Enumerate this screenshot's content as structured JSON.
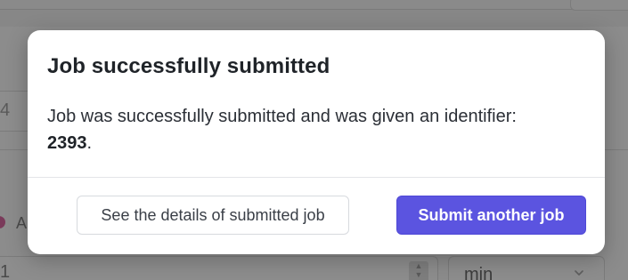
{
  "background": {
    "left_field_value": "4",
    "radio_label": "A",
    "number_field_value": "1",
    "unit_select_value": "min"
  },
  "modal": {
    "title": "Job successfully submitted",
    "message_prefix": "Job was successfully submitted and was given an identifier: ",
    "job_id": "2393",
    "message_suffix": ".",
    "secondary_button_label": "See the details of submitted job",
    "primary_button_label": "Submit another job"
  },
  "colors": {
    "primary_button": "#5b54e0",
    "overlay": "#878787"
  }
}
